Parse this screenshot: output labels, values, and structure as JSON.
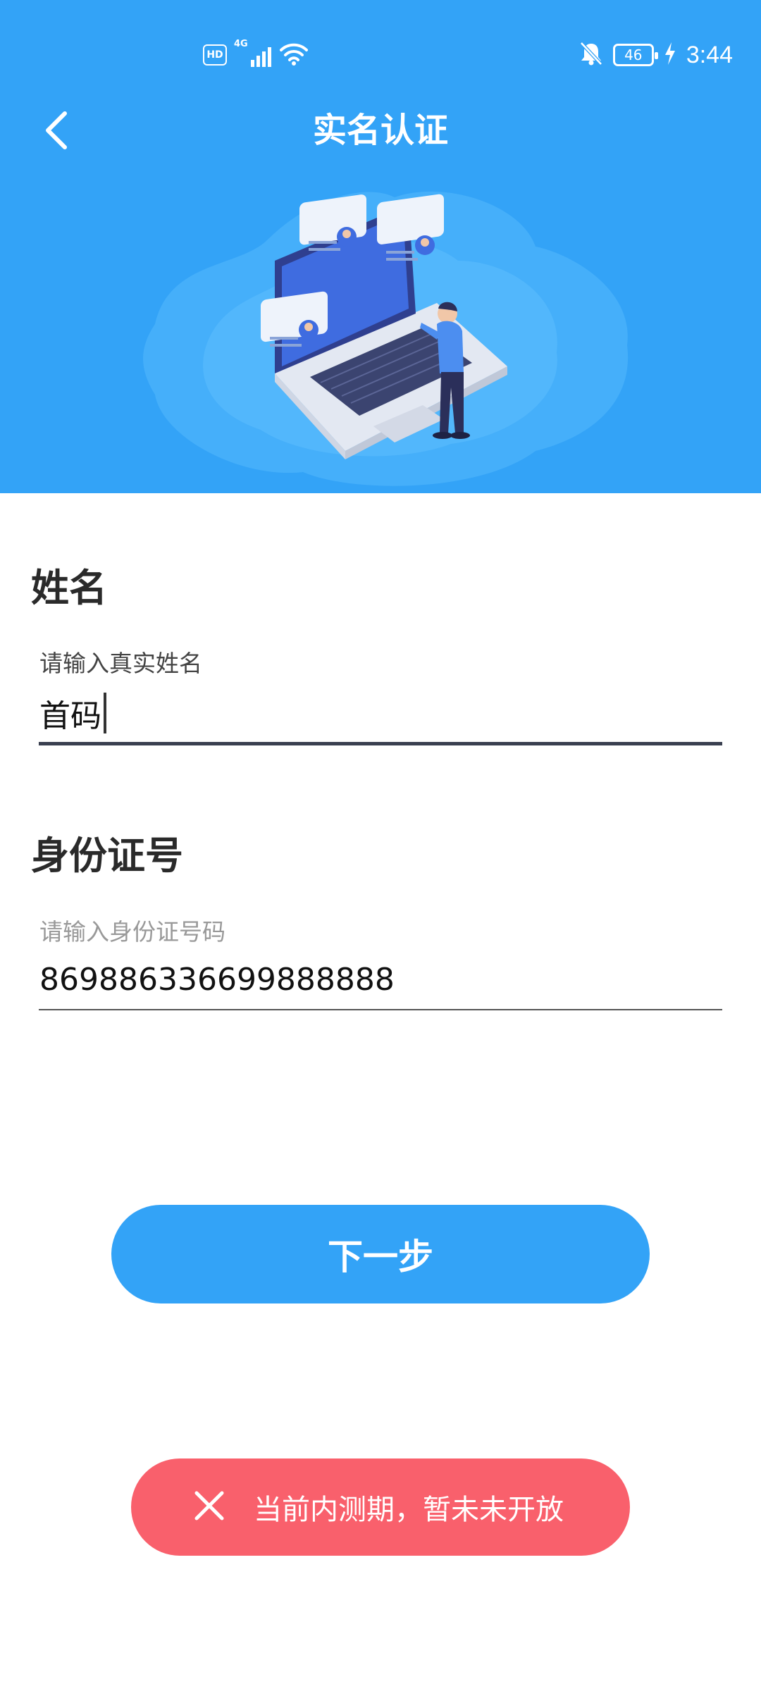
{
  "status_bar": {
    "hd_label": "HD",
    "network_label": "4G",
    "battery_level": "46",
    "time": "3:44"
  },
  "nav": {
    "title": "实名认证"
  },
  "form": {
    "name": {
      "label": "姓名",
      "hint": "请输入真实姓名",
      "value": "首码"
    },
    "id_number": {
      "label": "身份证号",
      "hint": "请输入身份证号码",
      "value": "869886336699888888"
    }
  },
  "actions": {
    "next_label": "下一步"
  },
  "toast": {
    "message": "当前内测期，暂未未开放"
  },
  "colors": {
    "primary": "#33a3f7",
    "toast_bg": "#f9606c",
    "text_dark": "#2a2a2a"
  },
  "icons": {
    "back": "chevron-left-icon",
    "toast": "close-icon",
    "wifi": "wifi-icon",
    "signal": "signal-icon",
    "mute": "bell-off-icon",
    "charging": "lightning-icon"
  }
}
